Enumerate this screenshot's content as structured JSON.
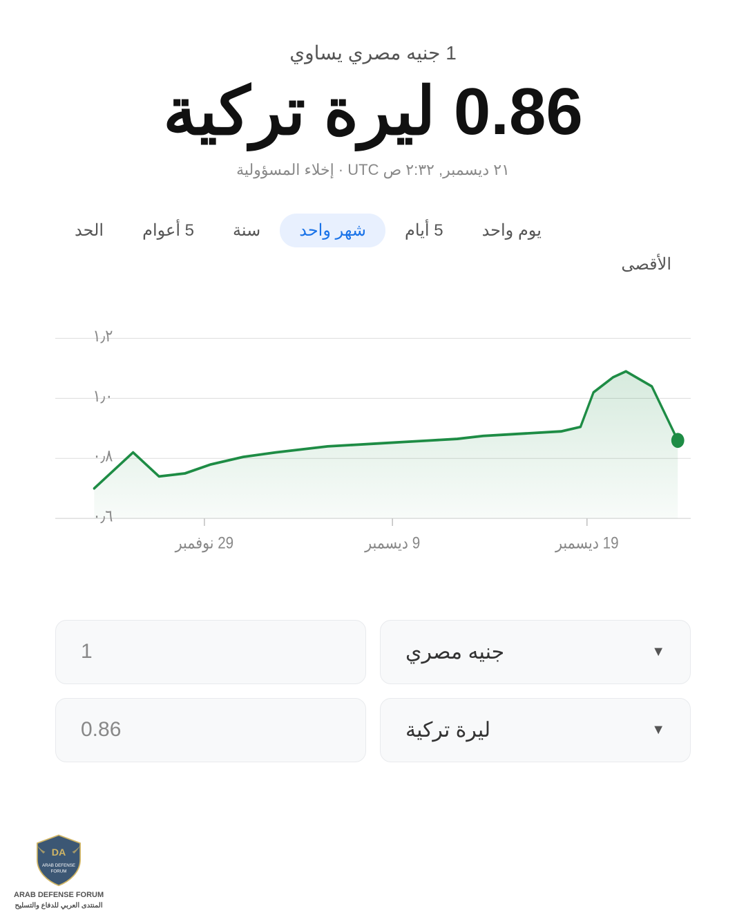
{
  "header": {
    "subtitle": "1 جنيه مصري يساوي",
    "main_value": "0.86 ليرة تركية",
    "timestamp": "٢١ ديسمبر, ٢:٣٢ ص UTC · إخلاء المسؤولية"
  },
  "period_tabs": [
    {
      "id": "1d",
      "label": "يوم واحد",
      "active": false
    },
    {
      "id": "5d",
      "label": "5 أيام",
      "active": false
    },
    {
      "id": "1m",
      "label": "شهر واحد",
      "active": true
    },
    {
      "id": "1y",
      "label": "سنة",
      "active": false
    },
    {
      "id": "5y",
      "label": "5 أعوام",
      "active": false
    },
    {
      "id": "max",
      "label": "الحد الأقصى",
      "active": false
    }
  ],
  "chart": {
    "y_labels": [
      "١٫٢",
      "١٫٠",
      "٠٫٨",
      "٠٫٦"
    ],
    "x_labels": [
      "19 ديسمبر",
      "9 ديسمبر",
      "29 نوفمبر"
    ],
    "accent_color": "#1e8c45",
    "fill_color": "rgba(30,140,69,0.12)"
  },
  "currency_from": {
    "name": "جنيه مصري",
    "value": "1",
    "placeholder": "1"
  },
  "currency_to": {
    "name": "ليرة تركية",
    "value": "0.86",
    "placeholder": "0.86"
  },
  "watermark": {
    "line1": "DA",
    "line2": "ARAB DEFENSE FORUM",
    "line3": "المنتدى العربي للدفاع والتسليح"
  }
}
